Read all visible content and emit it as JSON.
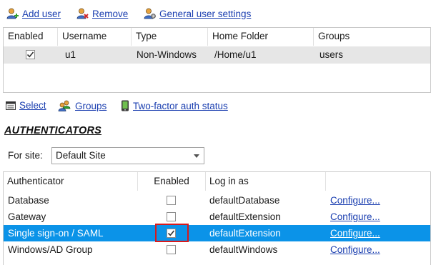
{
  "toolbar": {
    "add_user": "Add user",
    "remove": "Remove",
    "general_settings": "General user settings"
  },
  "users_table": {
    "columns": [
      "Enabled",
      "Username",
      "Type",
      "Home Folder",
      "Groups"
    ],
    "rows": [
      {
        "enabled": true,
        "username": "u1",
        "type": "Non-Windows",
        "home_folder": "/Home/u1",
        "groups": "users"
      }
    ]
  },
  "toolbar2": {
    "select": "Select",
    "groups": "Groups",
    "two_factor": "Two-factor auth status"
  },
  "authenticators": {
    "title": "AUTHENTICATORS",
    "for_site_label": "For site:",
    "site_value": "Default Site",
    "columns": [
      "Authenticator",
      "Enabled",
      "Log in as",
      ""
    ],
    "rows": [
      {
        "name": "Database",
        "enabled": false,
        "login_as": "defaultDatabase",
        "action": "Configure..."
      },
      {
        "name": "Gateway",
        "enabled": false,
        "login_as": "defaultExtension",
        "action": "Configure..."
      },
      {
        "name": "Single sign-on / SAML",
        "enabled": true,
        "login_as": "defaultExtension",
        "action": "Configure...",
        "selected": true
      },
      {
        "name": "Windows/AD Group",
        "enabled": false,
        "login_as": "defaultWindows",
        "action": "Configure..."
      }
    ]
  },
  "colors": {
    "link": "#1b3fb0",
    "selection": "#0b93e8",
    "highlight": "#d8191c"
  },
  "icons": {
    "add_user": "user-add-icon",
    "remove": "user-remove-icon",
    "general_settings": "user-settings-icon",
    "select": "list-icon",
    "groups": "group-icon",
    "two_factor": "phone-icon"
  }
}
